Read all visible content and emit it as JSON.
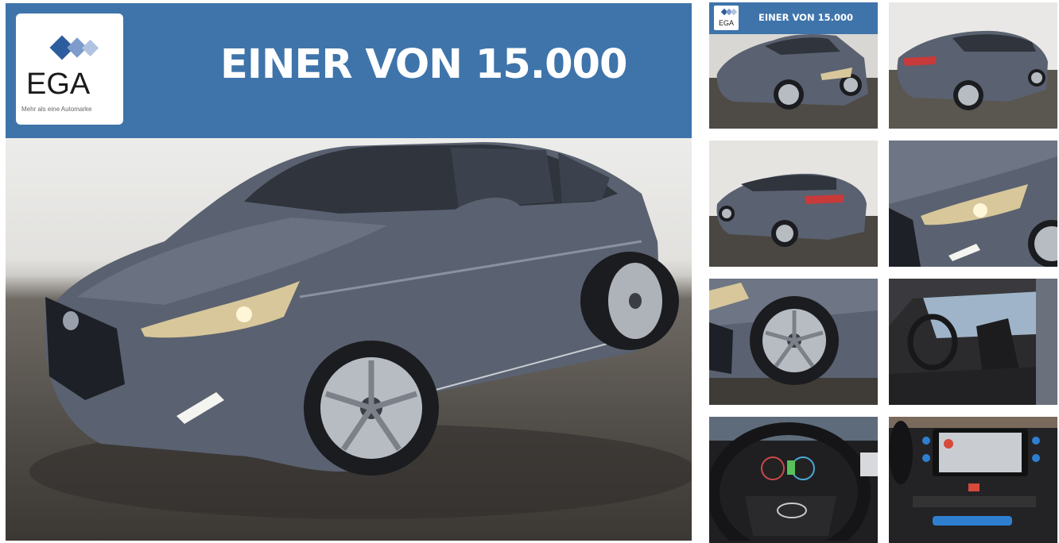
{
  "banner": {
    "logo_text": "EGA",
    "logo_tagline": "Mehr als eine Automarke",
    "headline": "EINER VON 15.000"
  },
  "gallery": {
    "thumbnails": [
      {
        "name": "thumb-front-side"
      },
      {
        "name": "thumb-rear-side"
      },
      {
        "name": "thumb-rear-left"
      },
      {
        "name": "thumb-headlight"
      },
      {
        "name": "thumb-wheel"
      },
      {
        "name": "thumb-interior"
      },
      {
        "name": "thumb-steering-wheel"
      },
      {
        "name": "thumb-infotainment"
      }
    ]
  },
  "colors": {
    "brand_blue": "#3f74ab",
    "car_gray": "#59606d",
    "logo_chevrons": [
      "#2c5d9e",
      "#7d9ccc",
      "#b0c3e0"
    ]
  }
}
